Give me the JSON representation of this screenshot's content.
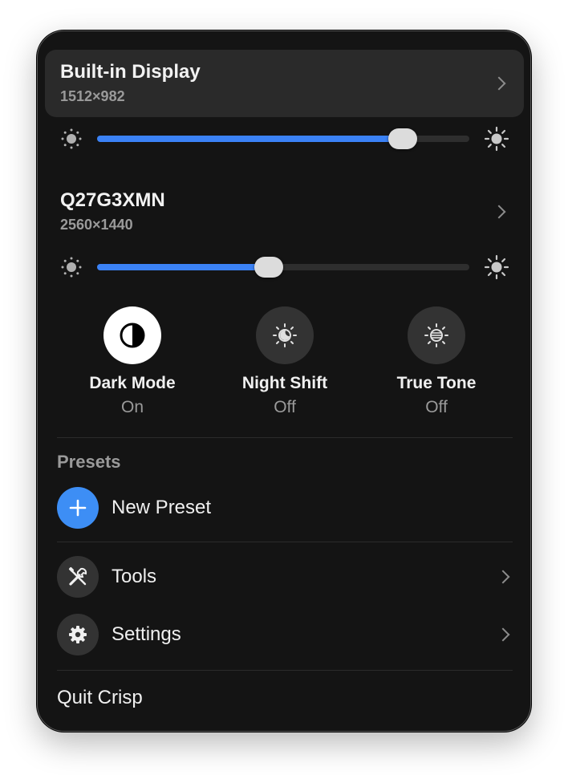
{
  "displays": [
    {
      "name": "Built-in Display",
      "resolution": "1512×982",
      "brightness": 0.82
    },
    {
      "name": "Q27G3XMN",
      "resolution": "2560×1440",
      "brightness": 0.46
    }
  ],
  "toggles": [
    {
      "label": "Dark Mode",
      "state": "On",
      "icon": "contrast-icon"
    },
    {
      "label": "Night Shift",
      "state": "Off",
      "icon": "night-shift-icon"
    },
    {
      "label": "True Tone",
      "state": "Off",
      "icon": "true-tone-icon"
    }
  ],
  "presets": {
    "title": "Presets",
    "new_preset_label": "New Preset"
  },
  "menu": {
    "tools_label": "Tools",
    "settings_label": "Settings",
    "quit_label": "Quit Crisp"
  },
  "colors": {
    "accent": "#3b82f6",
    "background": "#141414",
    "highlight": "#2a2a2a"
  }
}
